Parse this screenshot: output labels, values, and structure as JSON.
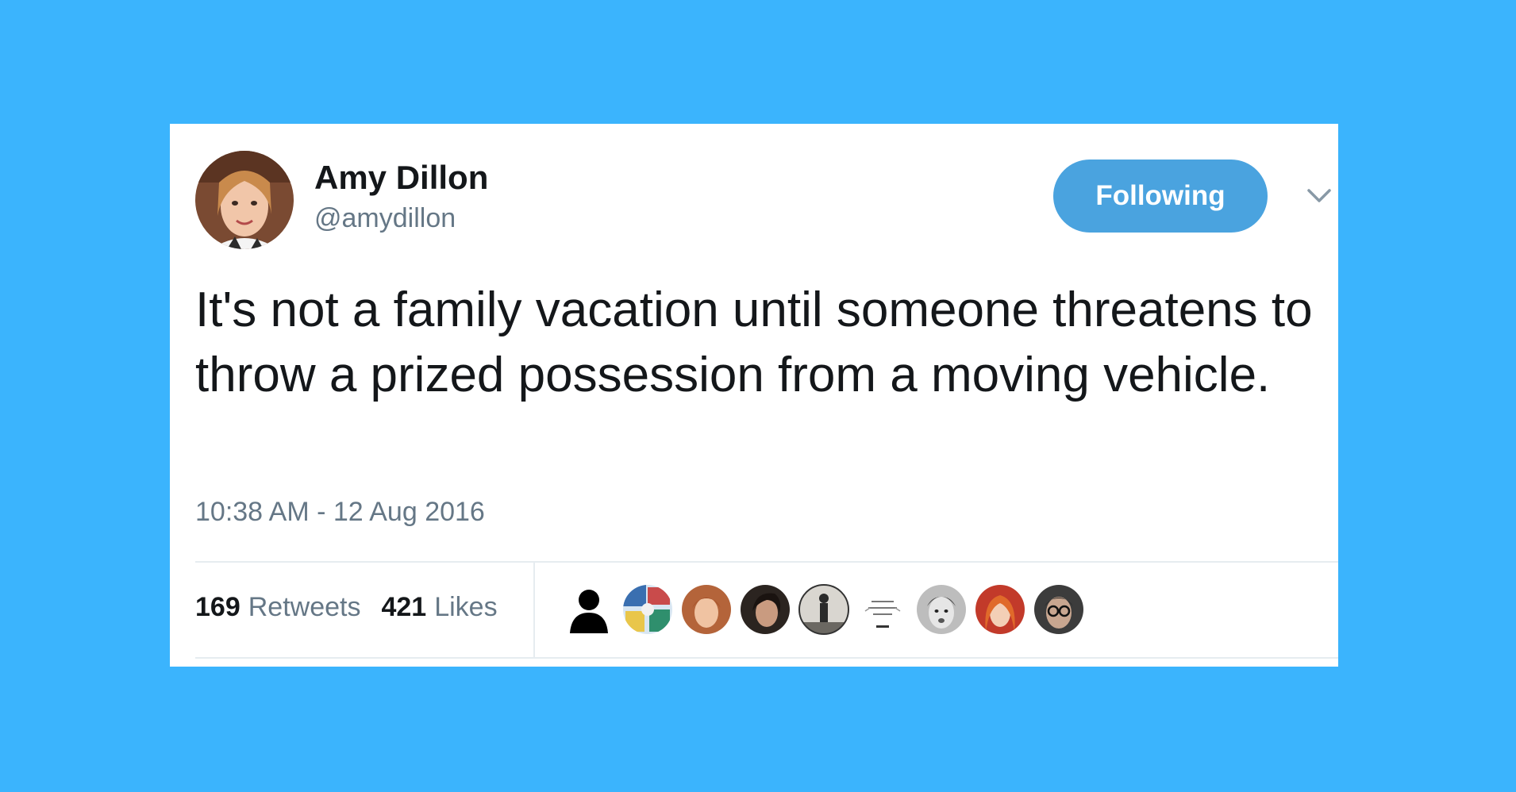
{
  "tweet": {
    "author_name": "Amy Dillon",
    "author_handle": "@amydillon",
    "follow_label": "Following",
    "text": "It's not a family vacation until someone threatens to throw a prized possession from a moving vehicle.",
    "timestamp": "10:38 AM - 12 Aug 2016",
    "retweets_count": "169",
    "retweets_label": "Retweets",
    "likes_count": "421",
    "likes_label": "Likes"
  },
  "icons": {
    "avatar": "author-avatar",
    "menu": "chevron-down-icon",
    "likers": [
      "default-silhouette-avatar",
      "colorful-collage-avatar",
      "redhead-avatar",
      "dark-hair-avatar",
      "bw-figure-avatar",
      "sketch-text-avatar",
      "bw-face-avatar",
      "red-hair-avatar",
      "glasses-face-avatar"
    ]
  },
  "colors": {
    "background": "#3bb4fd",
    "card": "#ffffff",
    "follow_button": "#4aa3df",
    "primary_text": "#14171a",
    "secondary_text": "#657786"
  }
}
